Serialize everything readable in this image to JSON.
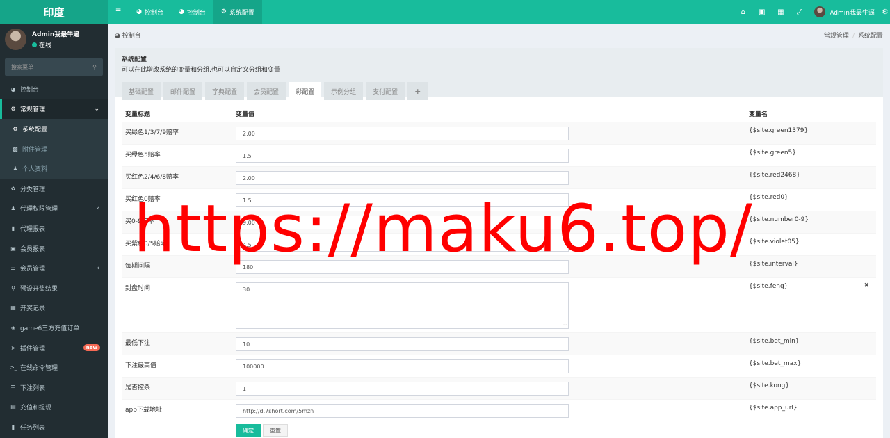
{
  "brand": "印度",
  "top_tabs": [
    {
      "label": "控制台",
      "icon": "dashboard-icon"
    },
    {
      "label": "控制台",
      "icon": "dashboard-icon"
    },
    {
      "label": "系统配置",
      "icon": "gear-icon"
    }
  ],
  "top_right": {
    "user": "Admin我最牛逼"
  },
  "sidebar": {
    "user_name": "Admin我最牛逼",
    "status": "在线",
    "search_placeholder": "搜索菜单",
    "items": [
      {
        "label": "控制台",
        "icon": "dashboard-icon"
      },
      {
        "label": "常规管理",
        "icon": "cogs-icon"
      },
      {
        "label": "系统配置",
        "icon": "gear-icon"
      },
      {
        "label": "附件管理",
        "icon": "file-image-icon"
      },
      {
        "label": "个人资料",
        "icon": "user-icon"
      },
      {
        "label": "分类管理",
        "icon": "leaf-icon"
      },
      {
        "label": "代理权限管理",
        "icon": "group-icon"
      },
      {
        "label": "代理报表",
        "icon": "book-icon"
      },
      {
        "label": "会员报表",
        "icon": "address-book-icon"
      },
      {
        "label": "会员管理",
        "icon": "list-icon"
      },
      {
        "label": "预设开奖结果",
        "icon": "search-icon"
      },
      {
        "label": "开奖记录",
        "icon": "calendar-icon"
      },
      {
        "label": "game6三方充值订单",
        "icon": "diamond-icon"
      },
      {
        "label": "插件管理",
        "icon": "rocket-icon",
        "badge": "new"
      },
      {
        "label": "在线命令管理",
        "icon": "terminal-icon"
      },
      {
        "label": "下注列表",
        "icon": "list-icon"
      },
      {
        "label": "充值和提现",
        "icon": "money-icon"
      },
      {
        "label": "任务列表",
        "icon": "book-icon"
      }
    ]
  },
  "breadcrumb": {
    "left": "控制台",
    "right": [
      "常规管理",
      "系统配置"
    ]
  },
  "panel": {
    "title": "系统配置",
    "desc": "可以在此增改系统的变量和分组,也可以自定义分组和变量",
    "tabs": [
      "基础配置",
      "邮件配置",
      "字典配置",
      "会员配置",
      "彩配置",
      "示例分组",
      "支付配置",
      "+"
    ],
    "active_tab": "彩配置"
  },
  "table": {
    "headers": [
      "变量标题",
      "变量值",
      "变量名"
    ],
    "rows": [
      {
        "title": "买绿色1/3/7/9赔率",
        "value": "2.00",
        "name": "{$site.green1379}"
      },
      {
        "title": "买绿色5赔率",
        "value": "1.5",
        "name": "{$site.green5}"
      },
      {
        "title": "买红色2/4/6/8赔率",
        "value": "2.00",
        "name": "{$site.red2468}"
      },
      {
        "title": "买红色0赔率",
        "value": "1.5",
        "name": "{$site.red0}"
      },
      {
        "title": "买0-9赔率",
        "value": "9.00",
        "name": "{$site.number0-9}"
      },
      {
        "title": "买紫色0/5赔率",
        "value": "4.5",
        "name": "{$site.violet05}"
      },
      {
        "title": "每期间隔",
        "value": "180",
        "name": "{$site.interval}"
      },
      {
        "title": "封盘时间",
        "value": "30",
        "name": "{$site.feng}"
      },
      {
        "title": "最低下注",
        "value": "10",
        "name": "{$site.bet_min}"
      },
      {
        "title": "下注最高值",
        "value": "100000",
        "name": "{$site.bet_max}"
      },
      {
        "title": "是否控杀",
        "value": "1",
        "name": "{$site.kong}"
      },
      {
        "title": "app下载地址",
        "value": "http://d.7short.com/5mzn",
        "name": "{$site.app_url}"
      }
    ],
    "submit": "确定",
    "reset": "重置"
  },
  "watermark": "https://maku6.top/",
  "colors": {
    "accent": "#18bc9c",
    "sidebar": "#222d32",
    "badge": "#f56954",
    "watermark": "#ff0000"
  }
}
